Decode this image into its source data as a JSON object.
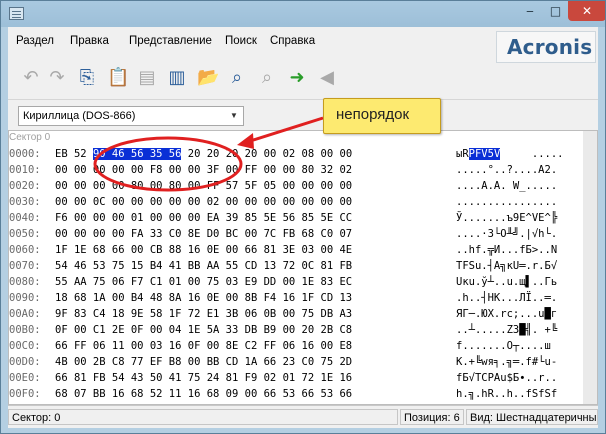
{
  "window": {
    "controls": {
      "minimize": "‒",
      "maximize": "□",
      "close": "✕"
    }
  },
  "menu": {
    "items": [
      "Раздел",
      "Правка",
      "Представление",
      "Поиск",
      "Справка"
    ]
  },
  "logo": {
    "text": "Acronis"
  },
  "toolbar": {
    "buttons": [
      {
        "icon": "undo-icon",
        "glyph": "↶",
        "enabled": false
      },
      {
        "icon": "redo-icon",
        "glyph": "↷",
        "enabled": false
      },
      {
        "icon": "copy-icon",
        "glyph": "⎘",
        "enabled": true
      },
      {
        "icon": "paste-icon",
        "glyph": "📋",
        "enabled": false
      },
      {
        "icon": "save-icon",
        "glyph": "▤",
        "enabled": false
      },
      {
        "icon": "book-icon",
        "glyph": "▥",
        "enabled": true
      },
      {
        "icon": "open-folder-icon",
        "glyph": "📂",
        "enabled": true
      },
      {
        "icon": "search-icon",
        "glyph": "⌕",
        "enabled": true
      },
      {
        "icon": "search-next-icon",
        "glyph": "⌕",
        "enabled": false
      },
      {
        "icon": "goto-arrow-icon",
        "glyph": "➜",
        "enabled": true
      },
      {
        "icon": "back-icon",
        "glyph": "◀",
        "enabled": false
      }
    ]
  },
  "encoding": {
    "selected": "Кириллица (DOS-866)"
  },
  "editor": {
    "sector_label": "Сектор 0",
    "rows": [
      {
        "offset": "0000:",
        "bytes": "EB 52 90 46 56 35 56 20 20 20 20 00 02 08 00 00",
        "ascii": "ыRРFV5V     ....."
      },
      {
        "offset": "0010:",
        "bytes": "00 00 00 00 00 F8 00 00 3F 00 FF 00 00 80 32 02",
        "ascii": ".....°..?....А2."
      },
      {
        "offset": "0020:",
        "bytes": "00 00 00 00 80 00 80 00 FF 57 5F 05 00 00 00 00",
        "ascii": "....А.А. W_....."
      },
      {
        "offset": "0030:",
        "bytes": "00 00 0C 00 00 00 00 00 02 00 00 00 00 00 00 00",
        "ascii": "................"
      },
      {
        "offset": "0040:",
        "bytes": "F6 00 00 00 01 00 00 00 EA 39 85 5E 56 85 5E CC",
        "ascii": "Ў.......ъ9Е^VЕ^╠"
      },
      {
        "offset": "0050:",
        "bytes": "00 00 00 00 FA 33 C0 8E D0 BC 00 7C FB 68 C0 07",
        "ascii": "....·3└О╨╝.|√h└."
      },
      {
        "offset": "0060:",
        "bytes": "1F 1E 68 66 00 CB 88 16 0E 00 66 81 3E 03 00 4E",
        "ascii": "..hf.╦И...fБ>..N"
      },
      {
        "offset": "0070:",
        "bytes": "54 46 53 75 15 B4 41 BB AA 55 CD 13 72 0C 81 FB",
        "ascii": "TFSu.┤A╗кU═.r.Б√"
      },
      {
        "offset": "0080:",
        "bytes": "55 AA 75 06 F7 C1 01 00 75 03 E9 DD 00 1E 83 EC",
        "ascii": "Uкu.ў┴..u.щ▌..Гь"
      },
      {
        "offset": "0090:",
        "bytes": "18 68 1A 00 B4 48 8A 16 0E 00 8B F4 16 1F CD 13",
        "ascii": ".h..┤HК...ЛЇ..═."
      },
      {
        "offset": "00A0:",
        "bytes": "9F 83 C4 18 9E 58 1F 72 E1 3B 06 0B 00 75 DB A3",
        "ascii": "ЯГ─.ЮX.rс;...u█г"
      },
      {
        "offset": "00B0:",
        "bytes": "0F 00 C1 2E 0F 00 04 1E 5A 33 DB B9 00 20 2B C8",
        "ascii": "..┴.....Z3█╣. +╚"
      },
      {
        "offset": "00C0:",
        "bytes": "66 FF 06 11 00 03 16 0F 00 8E C2 FF 06 16 00 E8",
        "ascii": "f.......О┬....ш"
      },
      {
        "offset": "00D0:",
        "bytes": "4B 00 2B C8 77 EF B8 00 BB CD 1A 66 23 C0 75 2D",
        "ascii": "K.+╚wя╕.╗═.f#└u-"
      },
      {
        "offset": "00E0:",
        "bytes": "66 81 FB 54 43 50 41 75 24 81 F9 02 01 72 1E 16",
        "ascii": "fБ√TCPAu$Б∙..r.."
      },
      {
        "offset": "00F0:",
        "bytes": "68 07 BB 16 68 52 11 16 68 09 00 66 53 66 53 66",
        "ascii": "h.╗.hR..h..fSfSf"
      }
    ]
  },
  "status": {
    "sector": "Сектор: 0",
    "position": "Позиция: 6",
    "view": "Вид: Шестнадцатеричный"
  },
  "callout": {
    "text": "непорядок"
  },
  "colors": {
    "selection": "#0a2fd6",
    "annotation": "#e02020",
    "callout_bg": "#fdea70"
  }
}
